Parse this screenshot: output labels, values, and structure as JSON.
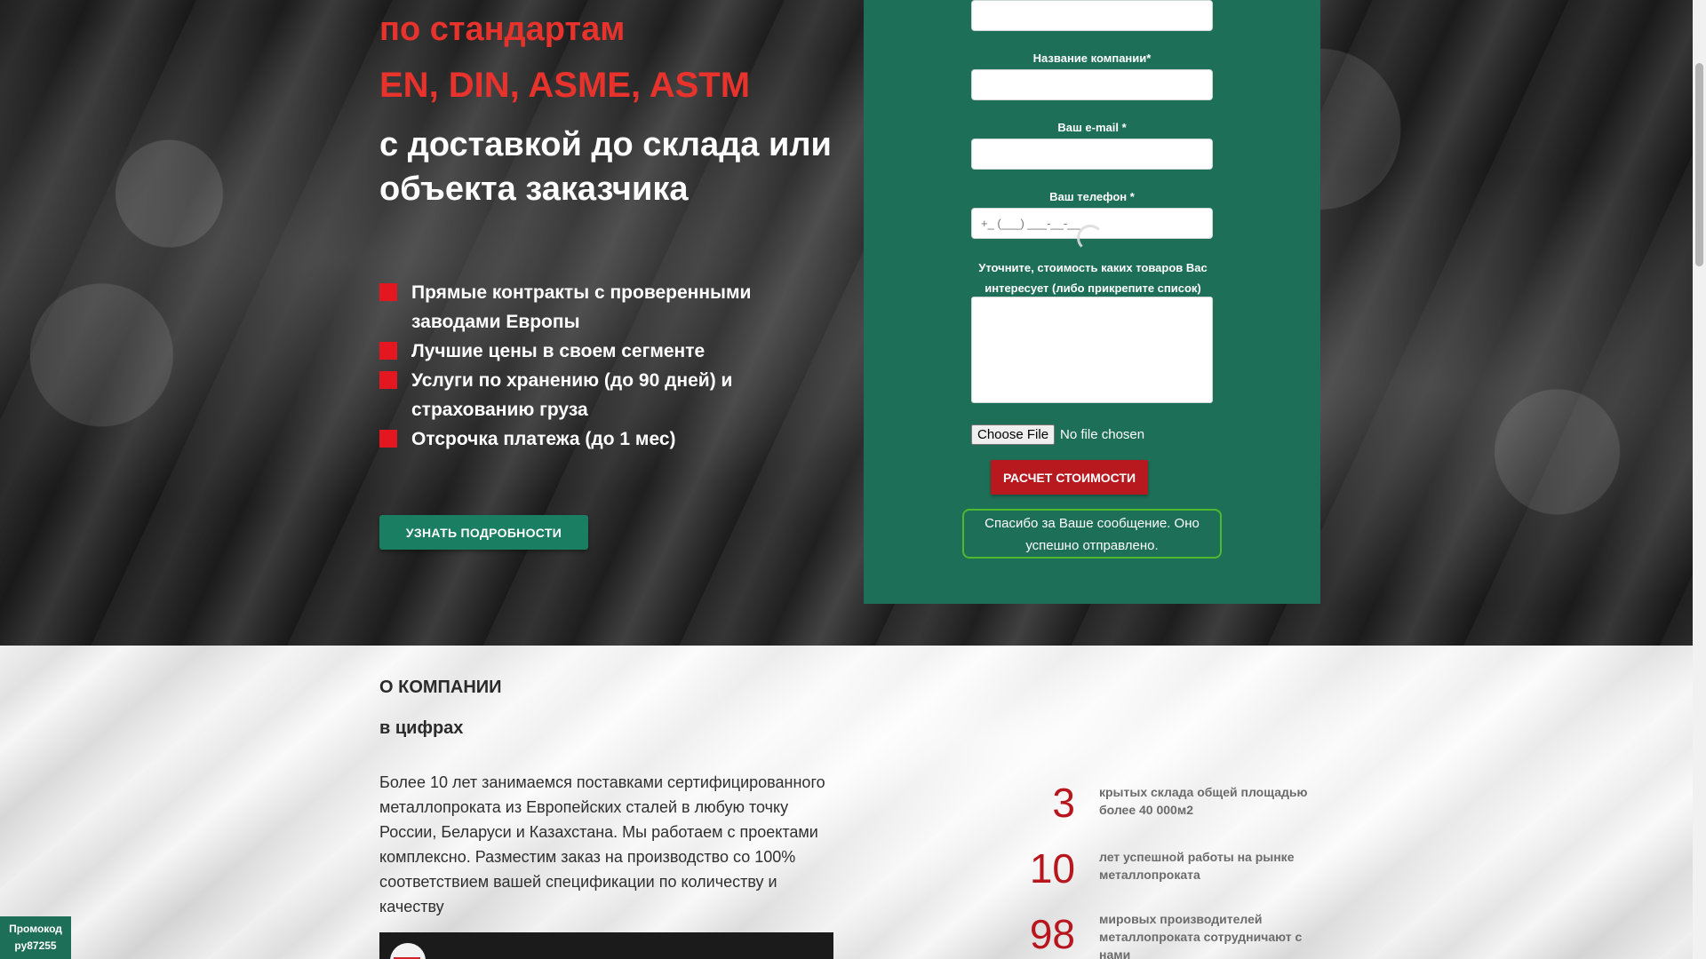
{
  "hero": {
    "headline_red_1": "по стандартам",
    "headline_red_2": "EN, DIN, ASME, ASTM",
    "headline_white": "с доставкой до склада или объекта заказчика",
    "benefits": [
      "Прямые контракты с проверенными заводами Европы",
      "Лучшие цены в своем сегменте",
      "Услуги по хранению (до 90 дней) и страхованию груза",
      "Отсрочка платежа (до 1 мес)"
    ],
    "details_button": "УЗНАТЬ ПОДРОБНОСТИ",
    "accent_red": "#e8322c",
    "accent_green": "#1a7e62"
  },
  "form": {
    "company_label": "Название компании*",
    "email_label": "Ваш e-mail *",
    "phone_label": "Ваш телефон *",
    "phone_placeholder": "+_ (___) ___-__-__",
    "goods_label": "Уточните, стоимость каких товаров Вас интересует (либо прикрепите список)",
    "file_button": "Choose File",
    "file_status": "No file chosen",
    "submit_button": "РАСЧЕТ СТОИМОСТИ",
    "success_message": "Спасибо за Ваше сообщение. Оно успешно отправлено.",
    "panel_color": "#1e6f57",
    "submit_color": "#b7191f"
  },
  "about": {
    "title": "О КОМПАНИИ",
    "subtitle": "в цифрах",
    "text": "Более 10 лет занимаемся поставками сертифицированного металлопроката из Европейских сталей в любую точку России, Беларуси и Казахстана. Мы работаем с проектами комплексно. Разместим заказ на производство со 100% соответствием вашей спецификации по количеству и качеству",
    "stats": [
      {
        "value": "3",
        "text": "крытых склада общей площадью более 40 000м2"
      },
      {
        "value": "10",
        "text": "лет успешной работы на рынке металлопроката"
      },
      {
        "value": "98",
        "text": "мировых производителей металлопроката сотрудничают с нами"
      }
    ]
  },
  "promo": {
    "label": "Промокод",
    "code": "ру87255"
  }
}
